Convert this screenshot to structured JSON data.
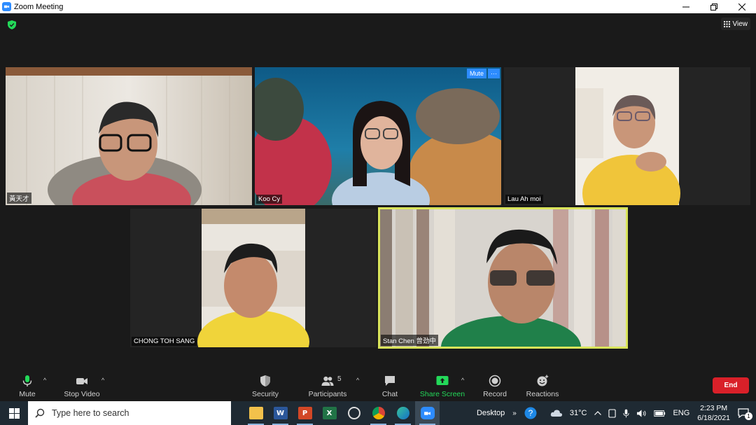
{
  "window": {
    "title": "Zoom Meeting"
  },
  "view_button": {
    "label": "View"
  },
  "participants": [
    {
      "name": "黃天才"
    },
    {
      "name": "Koo Cy",
      "hover_actions": [
        "Mute",
        "···"
      ]
    },
    {
      "name": "Lau Ah moi"
    },
    {
      "name": "CHONG TOH SANG"
    },
    {
      "name": "Stan Chen 曾劲中"
    }
  ],
  "toolbar": {
    "mute": "Mute",
    "stop_video": "Stop Video",
    "security": "Security",
    "participants": "Participants",
    "participants_count": "5",
    "chat": "Chat",
    "share_screen": "Share Screen",
    "record": "Record",
    "reactions": "Reactions",
    "end": "End"
  },
  "taskbar": {
    "search_placeholder": "Type here to search",
    "desktop_label": "Desktop",
    "temperature": "31°C",
    "language": "ENG",
    "time": "2:23 PM",
    "date": "6/18/2021",
    "notification_count": "1"
  },
  "colors": {
    "accent": "#2d8cff",
    "active_speaker": "#d9e45a",
    "share_screen": "#23d959",
    "end_button": "#d92029"
  }
}
